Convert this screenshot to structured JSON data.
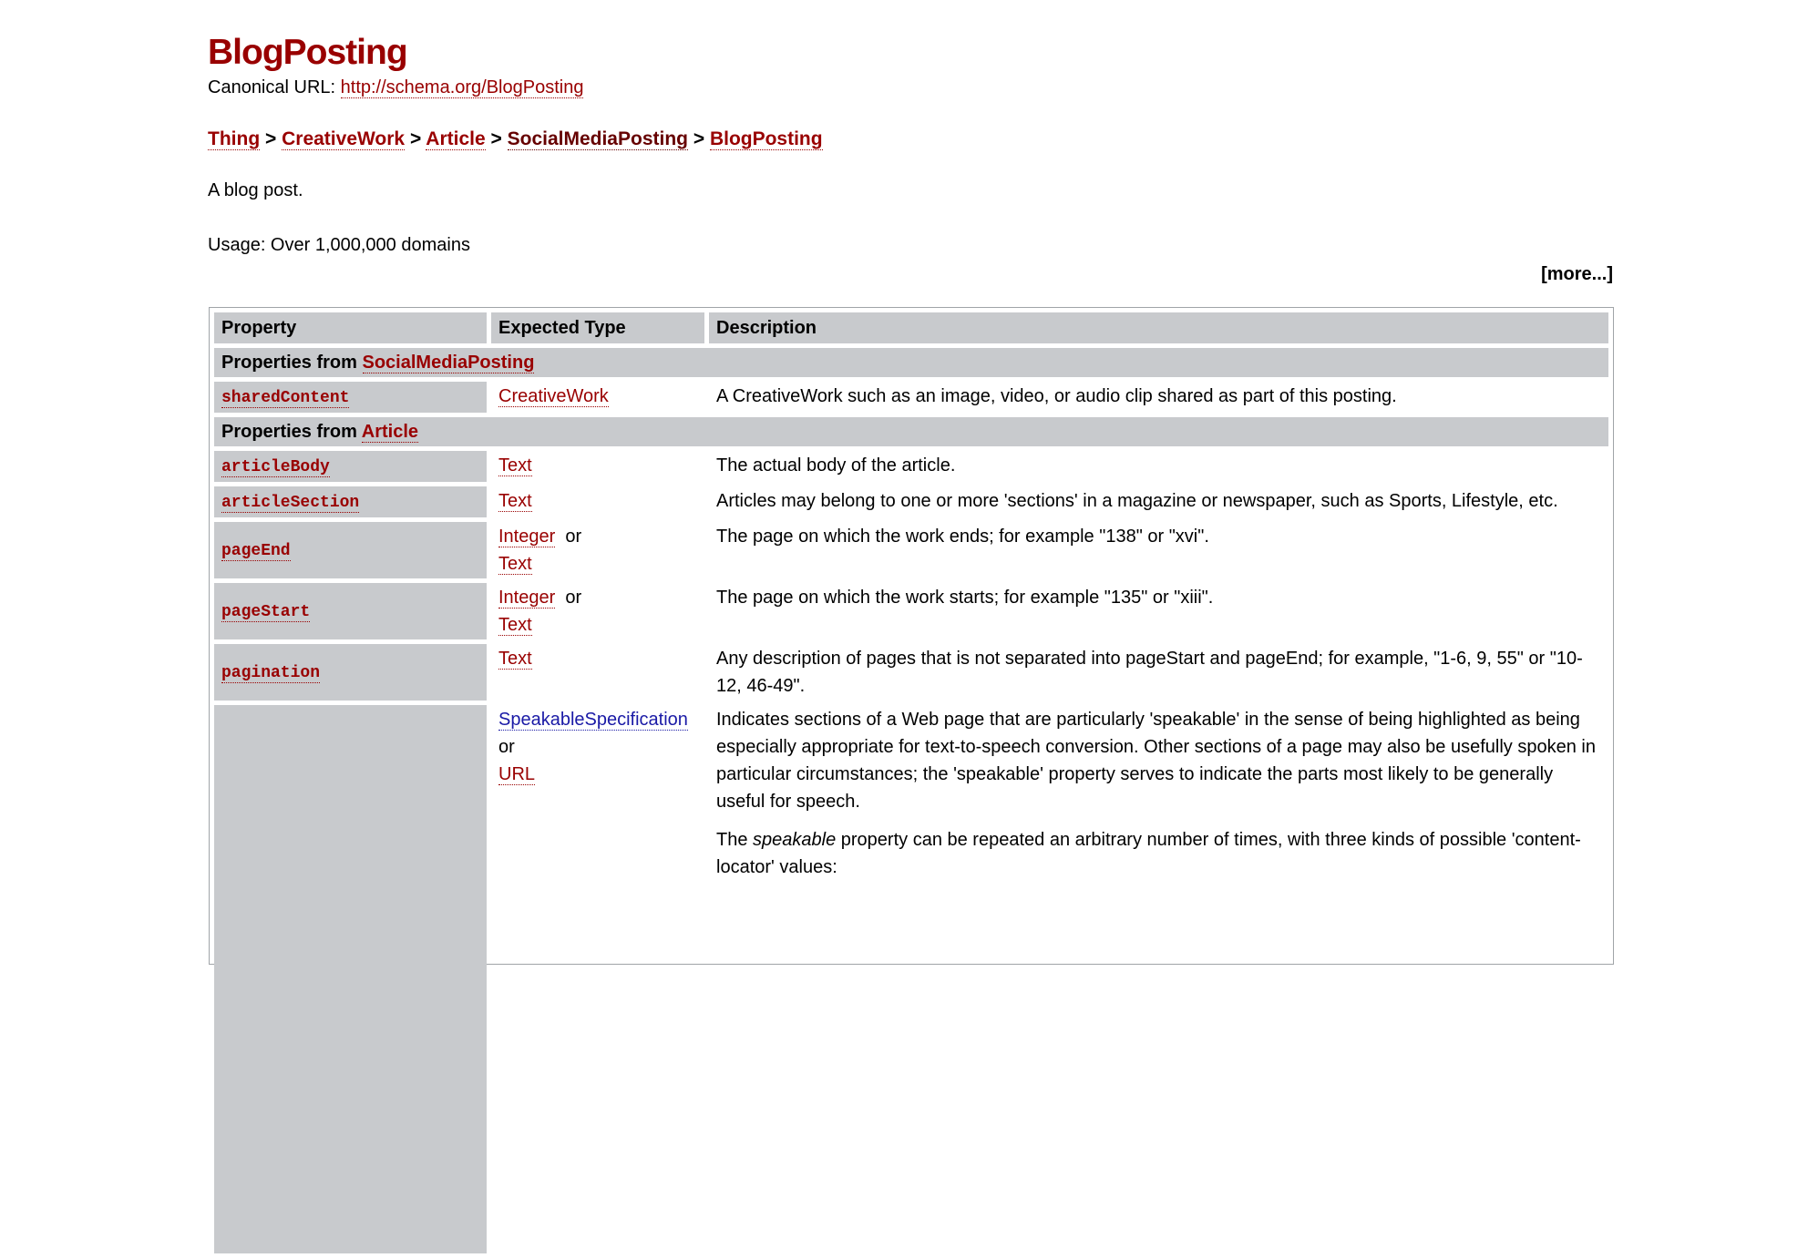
{
  "title": "BlogPosting",
  "canonical": {
    "label": "Canonical URL:",
    "url": "http://schema.org/BlogPosting"
  },
  "breadcrumb": [
    "Thing",
    "CreativeWork",
    "Article",
    "SocialMediaPosting",
    "BlogPosting"
  ],
  "breadcrumb_separator": ">",
  "description": "A blog post.",
  "usage": "Usage: Over 1,000,000 domains",
  "more_link": "[more...]",
  "table": {
    "headers": [
      "Property",
      "Expected Type",
      "Description"
    ],
    "section_prefix": "Properties from",
    "sections": [
      {
        "from": "SocialMediaPosting",
        "rows": [
          {
            "property": "sharedContent",
            "types": [
              "CreativeWork"
            ],
            "description": "A CreativeWork such as an image, video, or audio clip shared as part of this posting."
          }
        ]
      },
      {
        "from": "Article",
        "rows": [
          {
            "property": "articleBody",
            "types": [
              "Text"
            ],
            "description": "The actual body of the article."
          },
          {
            "property": "articleSection",
            "types": [
              "Text"
            ],
            "description": "Articles may belong to one or more 'sections' in a magazine or newspaper, such as Sports, Lifestyle, etc."
          },
          {
            "property": "pageEnd",
            "types": [
              "Integer",
              "Text"
            ],
            "description": "The page on which the work ends; for example \"138\" or \"xvi\"."
          },
          {
            "property": "pageStart",
            "types": [
              "Integer",
              "Text"
            ],
            "description": "The page on which the work starts; for example \"135\" or \"xiii\"."
          },
          {
            "property": "pagination",
            "types": [
              "Text"
            ],
            "description": "Any description of pages that is not separated into pageStart and pageEnd; for example, \"1-6, 9, 55\" or \"10-12, 46-49\"."
          }
        ]
      }
    ],
    "type_or": "or",
    "speakable_row": {
      "types": [
        "SpeakableSpecification",
        "URL"
      ],
      "description_1": "Indicates sections of a Web page that are particularly 'speakable' in the sense of being highlighted as being especially appropriate for text-to-speech conversion. Other sections of a page may also be usefully spoken in particular circumstances; the 'speakable' property serves to indicate the parts most likely to be generally useful for speech.",
      "description_2_pre": "The ",
      "description_2_em": "speakable",
      "description_2_post": " property can be repeated an arbitrary number of times, with three kinds of possible 'content-locator' values:"
    }
  }
}
